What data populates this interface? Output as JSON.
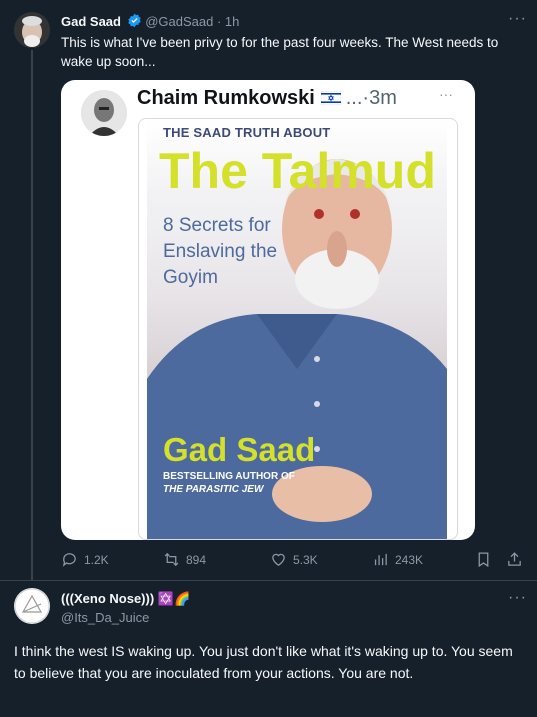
{
  "tweet": {
    "author_name": "Gad Saad",
    "handle": "@GadSaad",
    "time": "· 1h",
    "text": "This is what I've been privy to for the past four weeks.  The West needs to wake up soon...",
    "quoted": {
      "author_name": "Chaim Rumkowski",
      "flag_label": "🇮🇱",
      "ellipsis": "...",
      "time": "·3m",
      "book": {
        "top_line": "THE SAAD TRUTH ABOUT",
        "title": "The Talmud",
        "subtitle": "8 Secrets for Enslaving the Goyim",
        "author": "Gad Saad",
        "tagline_1": "BESTSELLING AUTHOR OF",
        "tagline_2": "THE PARASITIC JEW"
      }
    },
    "actions": {
      "replies": "1.2K",
      "retweets": "894",
      "likes": "5.3K",
      "views": "243K"
    }
  },
  "reply": {
    "author_name": "(((Xeno Nose)))",
    "badges": "✡️🌈",
    "handle": "@Its_Da_Juice",
    "text": "I think the west IS waking up. You just don't like what it's waking up to. You seem to believe that you are inoculated from your actions. You are not."
  },
  "colors": {
    "background": "#15202b",
    "accent": "#1d9bf0",
    "muted": "#8b98a5",
    "title_yellow": "#d4e02a"
  }
}
